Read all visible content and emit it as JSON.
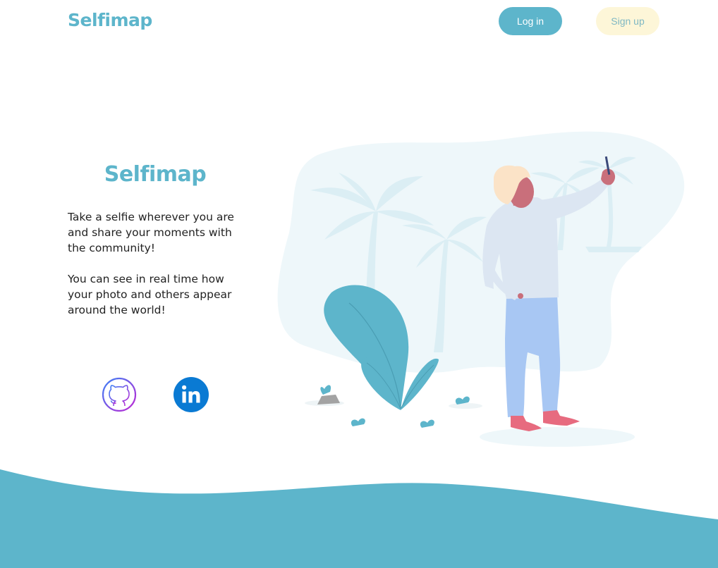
{
  "header": {
    "brand": "Selfimap",
    "login_label": "Log in",
    "signup_label": "Sign up"
  },
  "hero": {
    "title": "Selfimap",
    "paragraph_1": "Take a selfie wherever you are and share your moments with the community!",
    "paragraph_2": "You can see in real time how your photo and others appear around the world!"
  },
  "social": [
    {
      "icon": "github-icon"
    },
    {
      "icon": "linkedin-icon"
    }
  ],
  "colors": {
    "accent": "#5db5cb",
    "signup_bg": "#fdf6d8",
    "linkedin_blue": "#0a7ad3",
    "github_gradient_start": "#3b82f6",
    "github_gradient_end": "#c026d3",
    "wave": "#5db5cb"
  }
}
